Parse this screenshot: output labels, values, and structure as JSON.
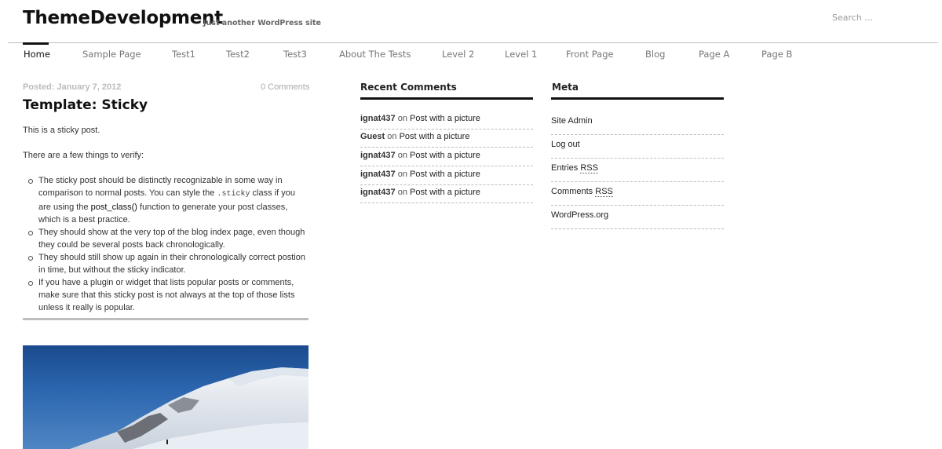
{
  "header": {
    "site_title": "ThemeDevelopment",
    "site_description": "Just another WordPress site",
    "search_placeholder": "Search …"
  },
  "nav": {
    "items": [
      {
        "label": "Home",
        "active": true
      },
      {
        "label": "Sample Page"
      },
      {
        "label": "Test1"
      },
      {
        "label": "Test2"
      },
      {
        "label": "Test3"
      },
      {
        "label": "About The Tests"
      },
      {
        "label": "Level 2"
      },
      {
        "label": "Level 1"
      },
      {
        "label": "Front Page"
      },
      {
        "label": "Blog"
      },
      {
        "label": "Page A"
      },
      {
        "label": "Page B"
      }
    ]
  },
  "post": {
    "date": "Posted: January 7, 2012",
    "comments": "0 Comments",
    "title": "Template: Sticky",
    "intro": "This is a sticky post.",
    "verify": "There are a few things to verify:",
    "bullets": {
      "b1_a": "The sticky post should be distinctly recognizable in some way in comparison to normal posts. You can style the ",
      "b1_code": ".sticky",
      "b1_b": " class if you are using the ",
      "b1_fn": "post_class()",
      "b1_c": " function to generate your post classes, which is a best practice.",
      "b2": "They should show at the very top of the blog index page, even though they could be several posts back chronologically.",
      "b3": "They should still show up again in their chronologically correct postion in time, but without the sticky indicator.",
      "b4": "If you have a plugin or widget that lists popular posts or comments, make sure that this sticky post is not always at the top of those lists unless it really is popular."
    }
  },
  "recent_comments": {
    "title": "Recent Comments",
    "items": [
      {
        "author": "ignat437",
        "on": "on",
        "post": "Post with a picture"
      },
      {
        "author": "Guest",
        "on": "on",
        "post": "Post with a picture"
      },
      {
        "author": "ignat437",
        "on": "on",
        "post": "Post with a picture"
      },
      {
        "author": "ignat437",
        "on": "on",
        "post": "Post with a picture"
      },
      {
        "author": "ignat437",
        "on": "on",
        "post": "Post with a picture"
      }
    ]
  },
  "meta": {
    "title": "Meta",
    "site_admin": "Site Admin",
    "log_out": "Log out",
    "entries": "Entries",
    "comments": "Comments",
    "rss": "RSS",
    "wordpress": "WordPress.org"
  },
  "colors": {
    "accent": "#111111",
    "muted": "#777777",
    "rule": "#bdbdbd"
  }
}
